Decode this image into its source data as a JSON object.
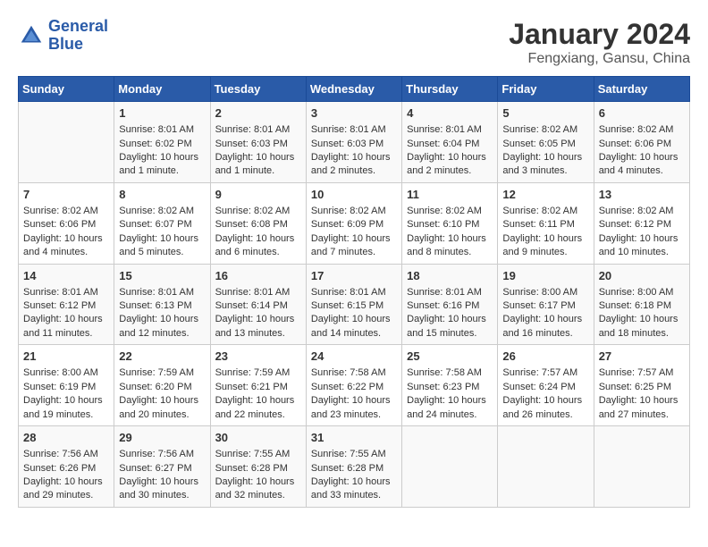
{
  "header": {
    "logo_line1": "General",
    "logo_line2": "Blue",
    "month": "January 2024",
    "location": "Fengxiang, Gansu, China"
  },
  "weekdays": [
    "Sunday",
    "Monday",
    "Tuesday",
    "Wednesday",
    "Thursday",
    "Friday",
    "Saturday"
  ],
  "weeks": [
    [
      {
        "day": "",
        "content": ""
      },
      {
        "day": "1",
        "content": "Sunrise: 8:01 AM\nSunset: 6:02 PM\nDaylight: 10 hours\nand 1 minute."
      },
      {
        "day": "2",
        "content": "Sunrise: 8:01 AM\nSunset: 6:03 PM\nDaylight: 10 hours\nand 1 minute."
      },
      {
        "day": "3",
        "content": "Sunrise: 8:01 AM\nSunset: 6:03 PM\nDaylight: 10 hours\nand 2 minutes."
      },
      {
        "day": "4",
        "content": "Sunrise: 8:01 AM\nSunset: 6:04 PM\nDaylight: 10 hours\nand 2 minutes."
      },
      {
        "day": "5",
        "content": "Sunrise: 8:02 AM\nSunset: 6:05 PM\nDaylight: 10 hours\nand 3 minutes."
      },
      {
        "day": "6",
        "content": "Sunrise: 8:02 AM\nSunset: 6:06 PM\nDaylight: 10 hours\nand 4 minutes."
      }
    ],
    [
      {
        "day": "7",
        "content": "Sunrise: 8:02 AM\nSunset: 6:06 PM\nDaylight: 10 hours\nand 4 minutes."
      },
      {
        "day": "8",
        "content": "Sunrise: 8:02 AM\nSunset: 6:07 PM\nDaylight: 10 hours\nand 5 minutes."
      },
      {
        "day": "9",
        "content": "Sunrise: 8:02 AM\nSunset: 6:08 PM\nDaylight: 10 hours\nand 6 minutes."
      },
      {
        "day": "10",
        "content": "Sunrise: 8:02 AM\nSunset: 6:09 PM\nDaylight: 10 hours\nand 7 minutes."
      },
      {
        "day": "11",
        "content": "Sunrise: 8:02 AM\nSunset: 6:10 PM\nDaylight: 10 hours\nand 8 minutes."
      },
      {
        "day": "12",
        "content": "Sunrise: 8:02 AM\nSunset: 6:11 PM\nDaylight: 10 hours\nand 9 minutes."
      },
      {
        "day": "13",
        "content": "Sunrise: 8:02 AM\nSunset: 6:12 PM\nDaylight: 10 hours\nand 10 minutes."
      }
    ],
    [
      {
        "day": "14",
        "content": "Sunrise: 8:01 AM\nSunset: 6:12 PM\nDaylight: 10 hours\nand 11 minutes."
      },
      {
        "day": "15",
        "content": "Sunrise: 8:01 AM\nSunset: 6:13 PM\nDaylight: 10 hours\nand 12 minutes."
      },
      {
        "day": "16",
        "content": "Sunrise: 8:01 AM\nSunset: 6:14 PM\nDaylight: 10 hours\nand 13 minutes."
      },
      {
        "day": "17",
        "content": "Sunrise: 8:01 AM\nSunset: 6:15 PM\nDaylight: 10 hours\nand 14 minutes."
      },
      {
        "day": "18",
        "content": "Sunrise: 8:01 AM\nSunset: 6:16 PM\nDaylight: 10 hours\nand 15 minutes."
      },
      {
        "day": "19",
        "content": "Sunrise: 8:00 AM\nSunset: 6:17 PM\nDaylight: 10 hours\nand 16 minutes."
      },
      {
        "day": "20",
        "content": "Sunrise: 8:00 AM\nSunset: 6:18 PM\nDaylight: 10 hours\nand 18 minutes."
      }
    ],
    [
      {
        "day": "21",
        "content": "Sunrise: 8:00 AM\nSunset: 6:19 PM\nDaylight: 10 hours\nand 19 minutes."
      },
      {
        "day": "22",
        "content": "Sunrise: 7:59 AM\nSunset: 6:20 PM\nDaylight: 10 hours\nand 20 minutes."
      },
      {
        "day": "23",
        "content": "Sunrise: 7:59 AM\nSunset: 6:21 PM\nDaylight: 10 hours\nand 22 minutes."
      },
      {
        "day": "24",
        "content": "Sunrise: 7:58 AM\nSunset: 6:22 PM\nDaylight: 10 hours\nand 23 minutes."
      },
      {
        "day": "25",
        "content": "Sunrise: 7:58 AM\nSunset: 6:23 PM\nDaylight: 10 hours\nand 24 minutes."
      },
      {
        "day": "26",
        "content": "Sunrise: 7:57 AM\nSunset: 6:24 PM\nDaylight: 10 hours\nand 26 minutes."
      },
      {
        "day": "27",
        "content": "Sunrise: 7:57 AM\nSunset: 6:25 PM\nDaylight: 10 hours\nand 27 minutes."
      }
    ],
    [
      {
        "day": "28",
        "content": "Sunrise: 7:56 AM\nSunset: 6:26 PM\nDaylight: 10 hours\nand 29 minutes."
      },
      {
        "day": "29",
        "content": "Sunrise: 7:56 AM\nSunset: 6:27 PM\nDaylight: 10 hours\nand 30 minutes."
      },
      {
        "day": "30",
        "content": "Sunrise: 7:55 AM\nSunset: 6:28 PM\nDaylight: 10 hours\nand 32 minutes."
      },
      {
        "day": "31",
        "content": "Sunrise: 7:55 AM\nSunset: 6:28 PM\nDaylight: 10 hours\nand 33 minutes."
      },
      {
        "day": "",
        "content": ""
      },
      {
        "day": "",
        "content": ""
      },
      {
        "day": "",
        "content": ""
      }
    ]
  ]
}
